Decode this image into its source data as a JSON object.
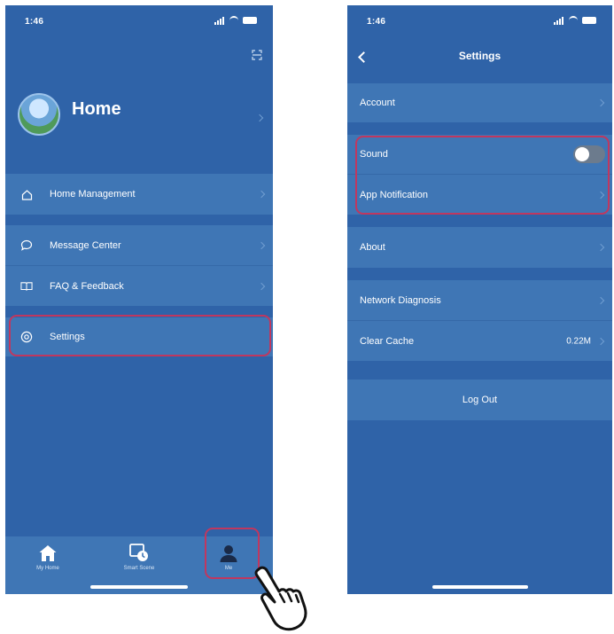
{
  "left": {
    "status_time": "1:46",
    "profile": {
      "name": "Home"
    },
    "menu": [
      {
        "label": "Home Management",
        "icon": "house-outline-icon"
      },
      {
        "label": "Message Center",
        "icon": "chat-bubble-icon"
      },
      {
        "label": "FAQ & Feedback",
        "icon": "book-icon"
      },
      {
        "label": "Settings",
        "icon": "gear-icon"
      }
    ],
    "tabs": [
      {
        "label": "My Home",
        "icon": "home-icon"
      },
      {
        "label": "Smart Scene",
        "icon": "scene-clock-icon"
      },
      {
        "label": "Me",
        "icon": "person-icon"
      }
    ]
  },
  "right": {
    "status_time": "1:46",
    "title": "Settings",
    "rows": {
      "account": "Account",
      "sound": "Sound",
      "app_notification": "App Notification",
      "about": "About",
      "network_diagnosis": "Network Diagnosis",
      "clear_cache": "Clear Cache",
      "clear_cache_value": "0.22M",
      "log_out": "Log Out"
    },
    "sound_enabled": false
  },
  "colors": {
    "background": "#2f63a8",
    "row": "#3f76b5",
    "highlight": "#c0375f",
    "text": "#ffffff"
  }
}
